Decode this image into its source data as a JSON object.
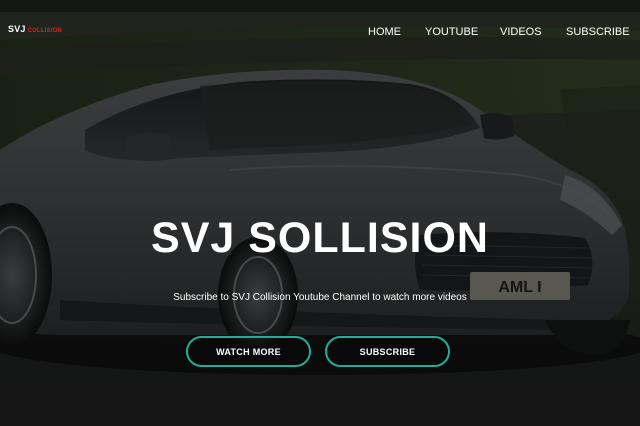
{
  "brand": {
    "name": "SVJ",
    "tagline": "COLLISION",
    "accent_color": "#e0201f"
  },
  "nav": {
    "items": [
      {
        "label": "HOME"
      },
      {
        "label": "YOUTUBE"
      },
      {
        "label": "VIDEOS"
      },
      {
        "label": "SUBSCRIBE"
      }
    ]
  },
  "hero": {
    "background": "dark grey sports car photo",
    "plate": "AML I",
    "title": "SVJ SOLLISION",
    "subtitle": "Subscribe to SVJ Collision Youtube Channel to watch more videos",
    "buttons": {
      "watch_more": "WATCH MORE",
      "subscribe": "SUBSCRIBE"
    },
    "button_border_color": "#1cae9a"
  }
}
